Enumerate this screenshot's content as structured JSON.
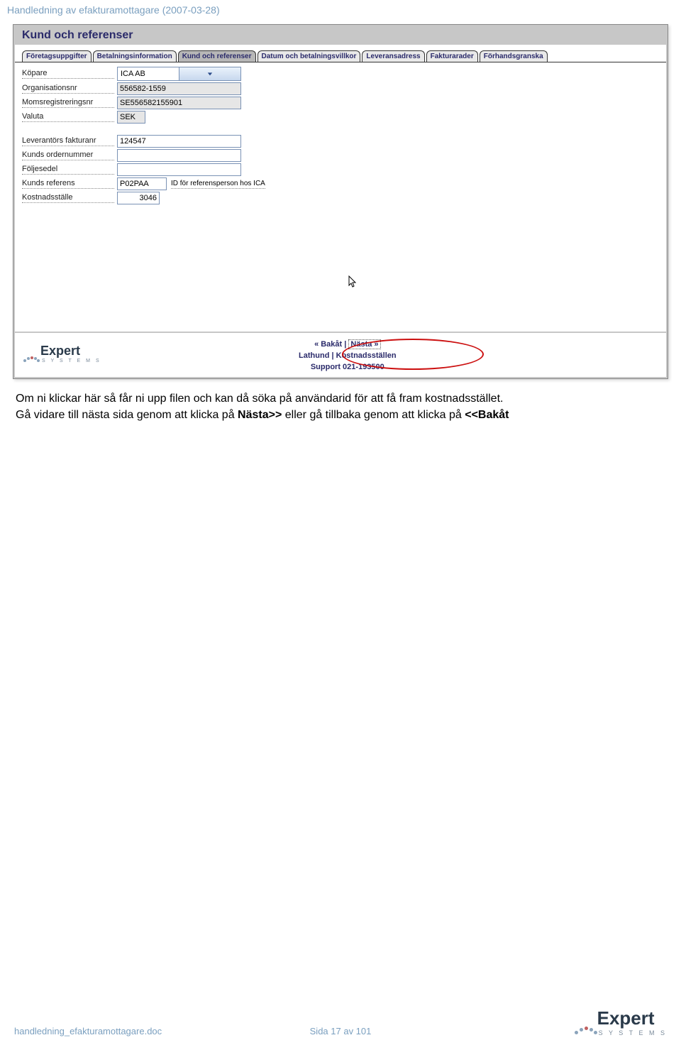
{
  "header": "Handledning av efakturamottagare (2007-03-28)",
  "panel_title": "Kund och referenser",
  "tabs": [
    {
      "label": "Företagsuppgifter"
    },
    {
      "label": "Betalningsinformation"
    },
    {
      "label": "Kund och referenser"
    },
    {
      "label": "Datum och betalningsvillkor"
    },
    {
      "label": "Leveransadress"
    },
    {
      "label": "Fakturarader"
    },
    {
      "label": "Förhandsgranska"
    }
  ],
  "fields": {
    "kopare_label": "Köpare",
    "kopare_value": "ICA AB",
    "orgnr_label": "Organisationsnr",
    "orgnr_value": "556582-1559",
    "momsnr_label": "Momsregistreringsnr",
    "momsnr_value": "SE556582155901",
    "valuta_label": "Valuta",
    "valuta_value": "SEK",
    "lev_fakturanr_label": "Leverantörs fakturanr",
    "lev_fakturanr_value": "124547",
    "kunds_ordernr_label": "Kunds ordernummer",
    "kunds_ordernr_value": "",
    "foljesedel_label": "Följesedel",
    "foljesedel_value": "",
    "kunds_referens_label": "Kunds referens",
    "kunds_referens_value": "P02PAA",
    "kunds_referens_hint": "ID för referensperson hos ICA",
    "kostnadsstalle_label": "Kostnadsställe",
    "kostnadsstalle_value": "3046"
  },
  "nav": {
    "back": "« Bakåt",
    "sep": "|",
    "next": "Nästa »",
    "lathund": "Lathund",
    "kostnadsstallen": "Kostnadsställen",
    "support": "Support 021-193500"
  },
  "logo": {
    "word": "Expert",
    "sub": "S Y S T E M S"
  },
  "explain": {
    "line1a": "Om ni klickar här så får ni upp filen och kan då söka på användarid för att få fram kostnadsstället.",
    "line2a": "Gå vidare till nästa sida genom att klicka på ",
    "line2b": "Nästa>>",
    "line2c": " eller gå tillbaka genom att klicka på ",
    "line2d": "<<Bakåt"
  },
  "footer": {
    "filename": "handledning_efakturamottagare.doc",
    "page": "Sida 17 av 101"
  }
}
